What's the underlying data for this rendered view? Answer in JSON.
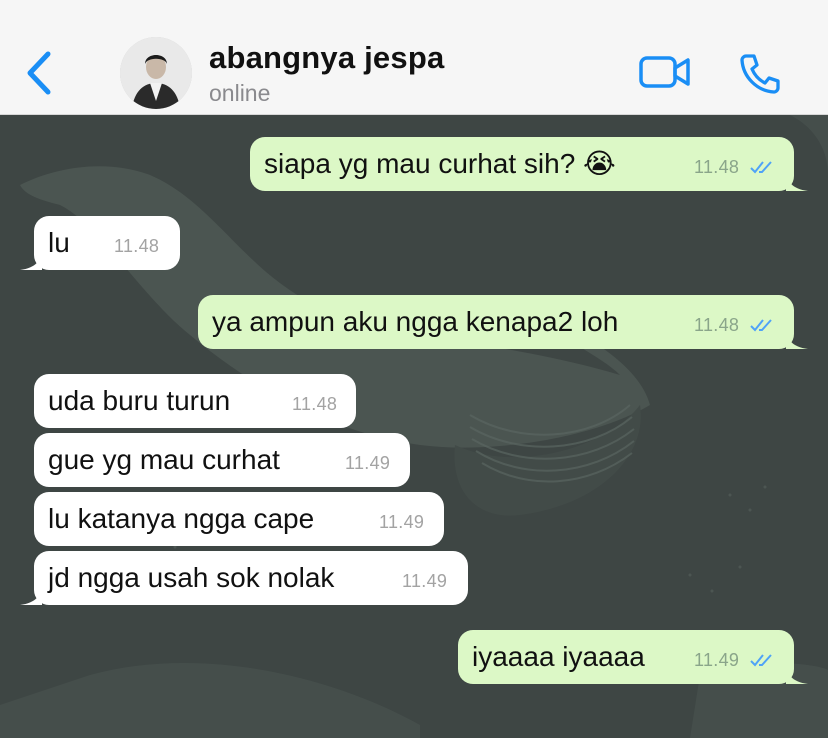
{
  "header": {
    "contact_name": "abangnya jespa",
    "status": "online"
  },
  "colors": {
    "accent": "#1a8ef5",
    "outgoing_bubble": "#dcf8c6",
    "incoming_bubble": "#ffffff",
    "chat_background": "#3e4644"
  },
  "icons": {
    "back": "chevron-left-icon",
    "video": "video-camera-icon",
    "call": "phone-icon",
    "read_receipt": "double-check-icon"
  },
  "messages": [
    {
      "direction": "out",
      "text": "siapa yg mau curhat sih? 😭",
      "time": "11.48",
      "read": true
    },
    {
      "direction": "in",
      "text": "lu",
      "time": "11.48"
    },
    {
      "direction": "out",
      "text": "ya ampun aku ngga kenapa2 loh",
      "time": "11.48",
      "read": true
    },
    {
      "direction": "in",
      "text": "uda buru turun",
      "time": "11.48"
    },
    {
      "direction": "in",
      "text": "gue yg mau curhat",
      "time": "11.49"
    },
    {
      "direction": "in",
      "text": "lu katanya ngga cape",
      "time": "11.49"
    },
    {
      "direction": "in",
      "text": "jd ngga usah sok nolak",
      "time": "11.49"
    },
    {
      "direction": "out",
      "text": "iyaaaa iyaaaa",
      "time": "11.49",
      "read": true
    }
  ]
}
